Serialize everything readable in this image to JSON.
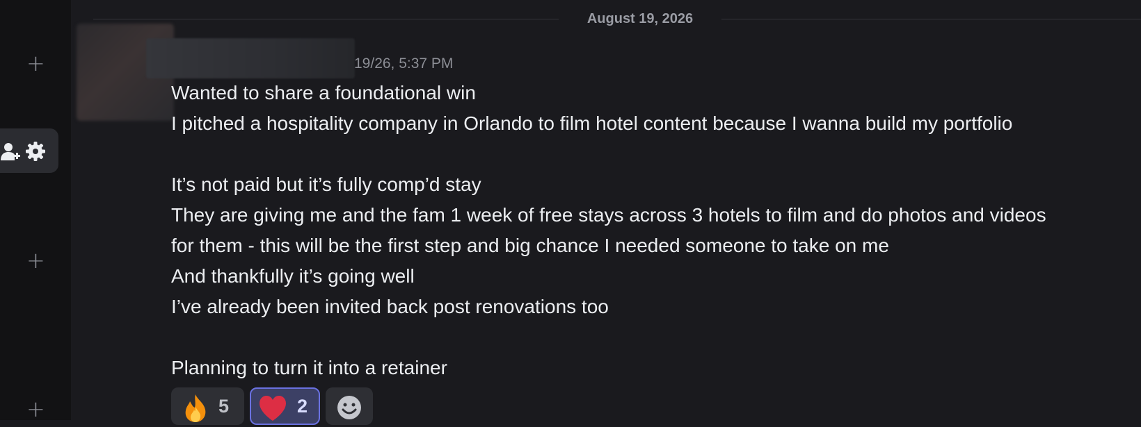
{
  "sidebar": {
    "add_buttons": [
      {
        "label": "+"
      },
      {
        "label": "+"
      },
      {
        "label": "+"
      }
    ],
    "active_row_icons": [
      "add-user-icon",
      "gear-icon"
    ]
  },
  "chat": {
    "date_divider": "August 19, 2026",
    "message": {
      "timestamp": "19/26, 5:37 PM",
      "lines": [
        "Wanted to share a foundational win",
        "I pitched a hospitality company in Orlando to film hotel content because I wanna build my portfolio",
        "",
        "It’s not paid but it’s fully comp’d stay",
        "They are giving me and the fam 1 week of free stays across 3 hotels to film and do photos and videos",
        "for them - this will be the first step and big chance I needed someone to take on me",
        "And thankfully it’s going well",
        "I’ve already been invited back post renovations too",
        "",
        "Planning to turn it into a retainer"
      ]
    },
    "reactions": [
      {
        "emoji": "fire-emoji",
        "count": "5",
        "active": false
      },
      {
        "emoji": "heart-emoji",
        "count": "2",
        "active": true
      },
      {
        "emoji": "add-reaction-icon",
        "count": "",
        "active": false
      }
    ]
  },
  "colors": {
    "background": "#1a1a1e",
    "sidebar": "#121214",
    "text": "#eceef1",
    "muted": "#8c8e95",
    "accent": "#6a71e0"
  }
}
